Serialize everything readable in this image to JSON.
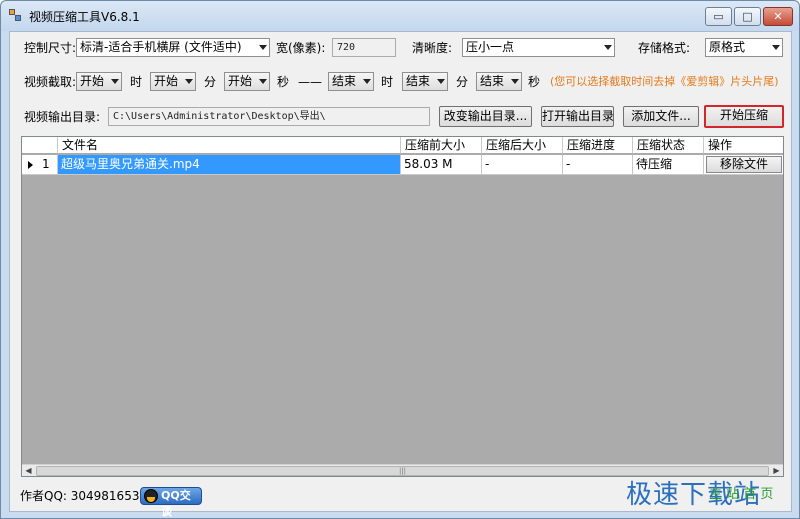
{
  "window": {
    "title": "视频压缩工具V6.8.1",
    "controls": {
      "minimize": "▭",
      "maximize": "□",
      "close": "✕"
    }
  },
  "row1": {
    "size_label": "控制尺寸:",
    "size_value": "标清-适合手机横屏 (文件适中)",
    "width_label": "宽(像素):",
    "width_value": "720",
    "clarity_label": "清晰度:",
    "clarity_value": "压小一点",
    "format_label": "存储格式:",
    "format_value": "原格式"
  },
  "row2": {
    "clip_label": "视频截取:",
    "start_hour": "开始",
    "hour_unit": "时",
    "start_min": "开始",
    "min_unit": "分",
    "start_sec": "开始",
    "sec_unit": "秒",
    "dash": "——",
    "end_hour": "结束",
    "hour_unit2": "时",
    "end_min": "结束",
    "min_unit2": "分",
    "end_sec": "结束",
    "sec_unit2": "秒",
    "hint": "(您可以选择截取时间去掉《爱剪辑》片头片尾)"
  },
  "row3": {
    "output_label": "视频输出目录:",
    "output_path": "C:\\Users\\Administrator\\Desktop\\导出\\",
    "change_dir": "改变输出目录...",
    "open_dir": "打开输出目录",
    "add_file": "添加文件...",
    "start": "开始压缩"
  },
  "table": {
    "columns": [
      "文件名",
      "压缩前大小",
      "压缩后大小",
      "压缩进度",
      "压缩状态",
      "操作"
    ],
    "rows": [
      {
        "index": "1",
        "filename": "超级马里奥兄弟通关.mp4",
        "size_before": "58.03 M",
        "size_after": "-",
        "progress": "-",
        "status": "待压缩",
        "action": "移除文件"
      }
    ],
    "scroll_grip": "|||"
  },
  "footer": {
    "author_qq": "作者QQ: 3049816538",
    "qq_chat": "QQ交谈"
  },
  "watermark": {
    "main": "极速下载站",
    "sub": "主 站 首 页"
  },
  "colors": {
    "titlebar": "#c3d7ee",
    "selection": "#3399ff",
    "hint": "#e57a1c",
    "start_border": "#d3262b",
    "grid_bg": "#ababab"
  }
}
